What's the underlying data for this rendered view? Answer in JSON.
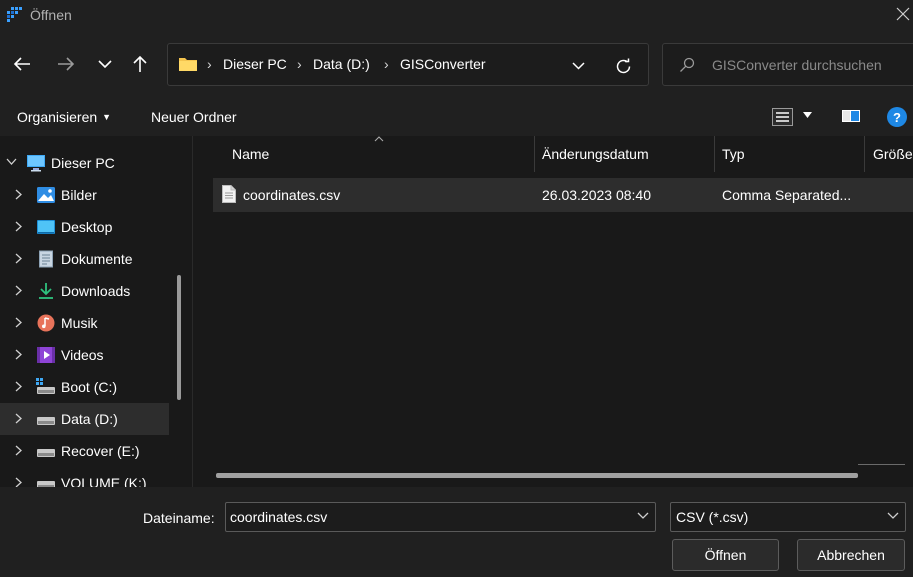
{
  "window": {
    "title": "Öffnen"
  },
  "address": {
    "crumbs": [
      "Dieser PC",
      "Data (D:)",
      "GISConverter"
    ],
    "separator": "›"
  },
  "search": {
    "placeholder": "GISConverter durchsuchen"
  },
  "commands": {
    "organize": "Organisieren",
    "new_folder": "Neuer Ordner",
    "help": "?"
  },
  "nav": {
    "items": [
      {
        "label": "Dieser PC",
        "icon": "computer-icon",
        "expanded": true
      },
      {
        "label": "Bilder",
        "icon": "pictures-icon"
      },
      {
        "label": "Desktop",
        "icon": "desktop-icon"
      },
      {
        "label": "Dokumente",
        "icon": "documents-icon"
      },
      {
        "label": "Downloads",
        "icon": "download-icon"
      },
      {
        "label": "Musik",
        "icon": "music-icon"
      },
      {
        "label": "Videos",
        "icon": "videos-icon"
      },
      {
        "label": "Boot (C:)",
        "icon": "system-drive-icon"
      },
      {
        "label": "Data (D:)",
        "icon": "drive-icon",
        "selected": true
      },
      {
        "label": "Recover (E:)",
        "icon": "drive-icon"
      },
      {
        "label": "VOLUME (K:)",
        "icon": "drive-icon"
      }
    ]
  },
  "columns": {
    "name": "Name",
    "modified": "Änderungsdatum",
    "type": "Typ",
    "size": "Größe"
  },
  "files": [
    {
      "name": "coordinates.csv",
      "modified": "26.03.2023 08:40",
      "type": "Comma Separated..."
    }
  ],
  "footer": {
    "filename_label": "Dateiname:",
    "filename_value": "coordinates.csv",
    "filter_value": "CSV (*.csv)",
    "open_label": "Öffnen",
    "cancel_label": "Abbrechen"
  },
  "colors": {
    "accent": "#1e88e5",
    "background": "#191919",
    "chrome": "#202020",
    "selection": "#2d2d2d"
  }
}
